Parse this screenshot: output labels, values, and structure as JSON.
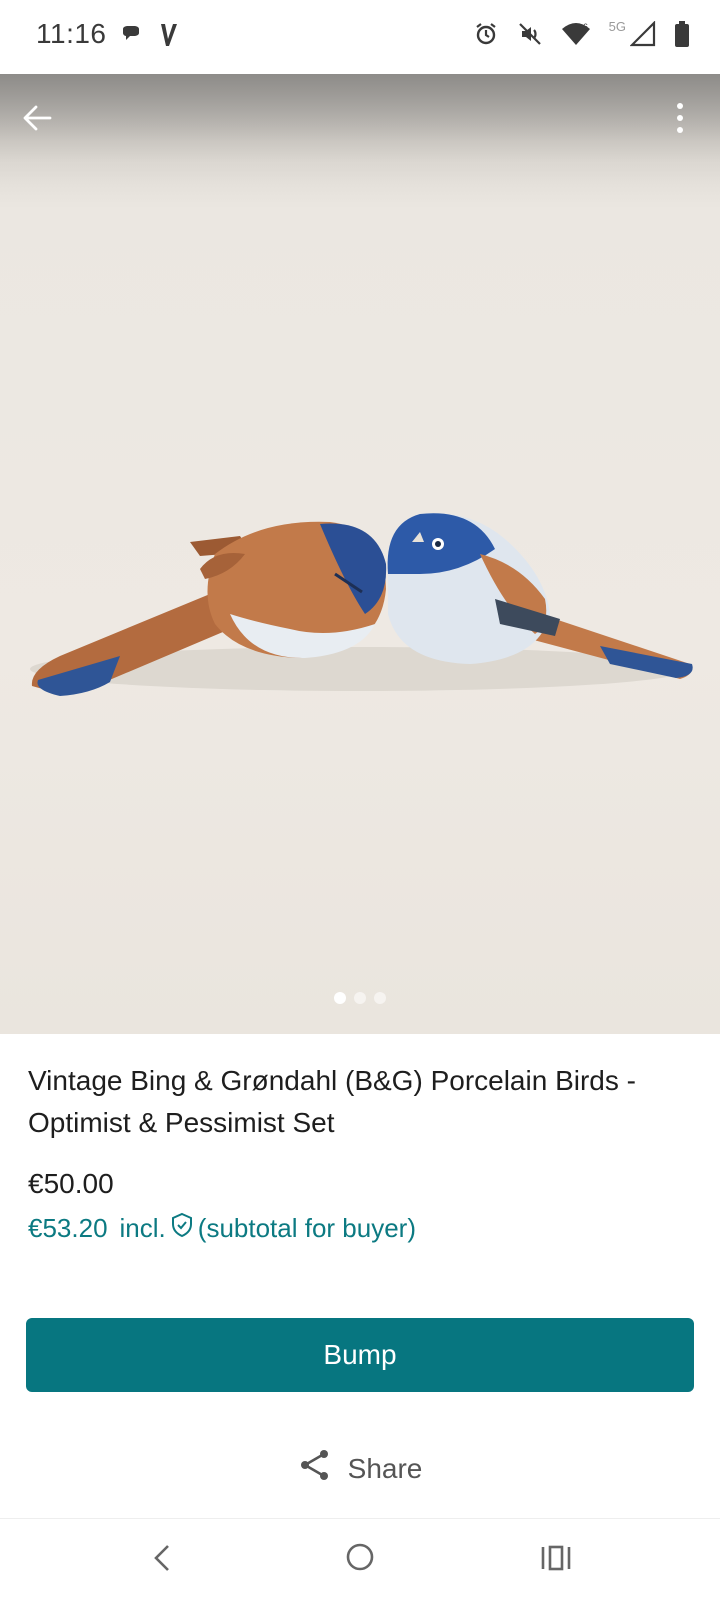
{
  "status_bar": {
    "time": "11:16",
    "network_label": "5G",
    "icons": [
      "chat-bubble-icon",
      "vinted-v-icon",
      "alarm-icon",
      "mute-icon",
      "wifi-icon",
      "signal-icon",
      "battery-icon"
    ]
  },
  "photo": {
    "page_count": 3,
    "active_page": 1,
    "icons": [
      "back-arrow-icon",
      "more-vert-icon"
    ]
  },
  "listing": {
    "title": "Vintage Bing & Grøndahl (B&G) Porcelain Birds - Optimist & Pessimist Set",
    "price": "€50.00",
    "buyer_price": "€53.20",
    "incl_label": "incl.",
    "subtotal_label": "(subtotal for buyer)"
  },
  "actions": {
    "bump_label": "Bump",
    "share_label": "Share"
  },
  "colors": {
    "accent": "#077680",
    "accent_text": "#0c7a82"
  }
}
